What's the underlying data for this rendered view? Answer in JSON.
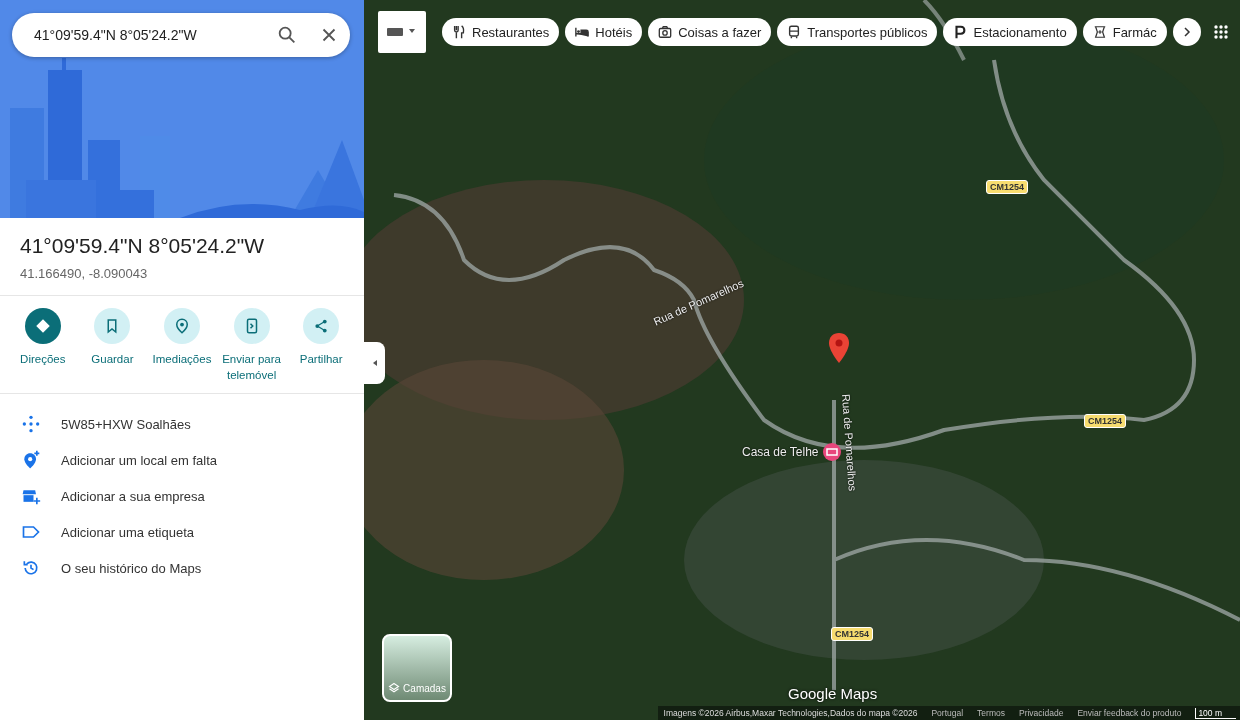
{
  "search": {
    "value": "41°09'59.4\"N 8°05'24.2\"W"
  },
  "place": {
    "title": "41°09'59.4\"N 8°05'24.2\"W",
    "coordinates": "41.166490, -8.090043"
  },
  "actions": [
    {
      "kind": "directions",
      "label": "Direções",
      "primary": true
    },
    {
      "kind": "save",
      "label": "Guardar",
      "primary": false
    },
    {
      "kind": "nearby",
      "label": "Imediações",
      "primary": false
    },
    {
      "kind": "send",
      "label": "Enviar para telemóvel",
      "primary": false
    },
    {
      "kind": "share",
      "label": "Partilhar",
      "primary": false
    }
  ],
  "details": [
    {
      "kind": "pluscode",
      "text": "5W85+HXW Soalhães"
    },
    {
      "kind": "add-place",
      "text": "Adicionar um local em falta"
    },
    {
      "kind": "business",
      "text": "Adicionar a sua empresa"
    },
    {
      "kind": "label",
      "text": "Adicionar uma etiqueta"
    },
    {
      "kind": "history",
      "text": "O seu histórico do Maps"
    }
  ],
  "map": {
    "categories": [
      {
        "kind": "restaurants",
        "label": "Restaurantes"
      },
      {
        "kind": "hotels",
        "label": "Hotéis"
      },
      {
        "kind": "things",
        "label": "Coisas a fazer"
      },
      {
        "kind": "transit",
        "label": "Transportes públicos"
      },
      {
        "kind": "parking",
        "label": "Estacionamento"
      },
      {
        "kind": "pharmacy",
        "label": "Farmác"
      }
    ],
    "street_labels": [
      "Rua de Pomarelhos",
      "Rua de Pomarelhos"
    ],
    "road_shields": [
      "CM1254",
      "CM1254",
      "CM1254"
    ],
    "place_label": "Casa de Telhe",
    "layers_button": "Camadas",
    "logo": "Google Maps",
    "footer": [
      "Imagens ©2026 Airbus,Maxar Technologies,Dados do mapa ©2026",
      "Portugal",
      "Termos",
      "Privacidade",
      "Enviar feedback do produto"
    ],
    "scale": "100 m"
  }
}
